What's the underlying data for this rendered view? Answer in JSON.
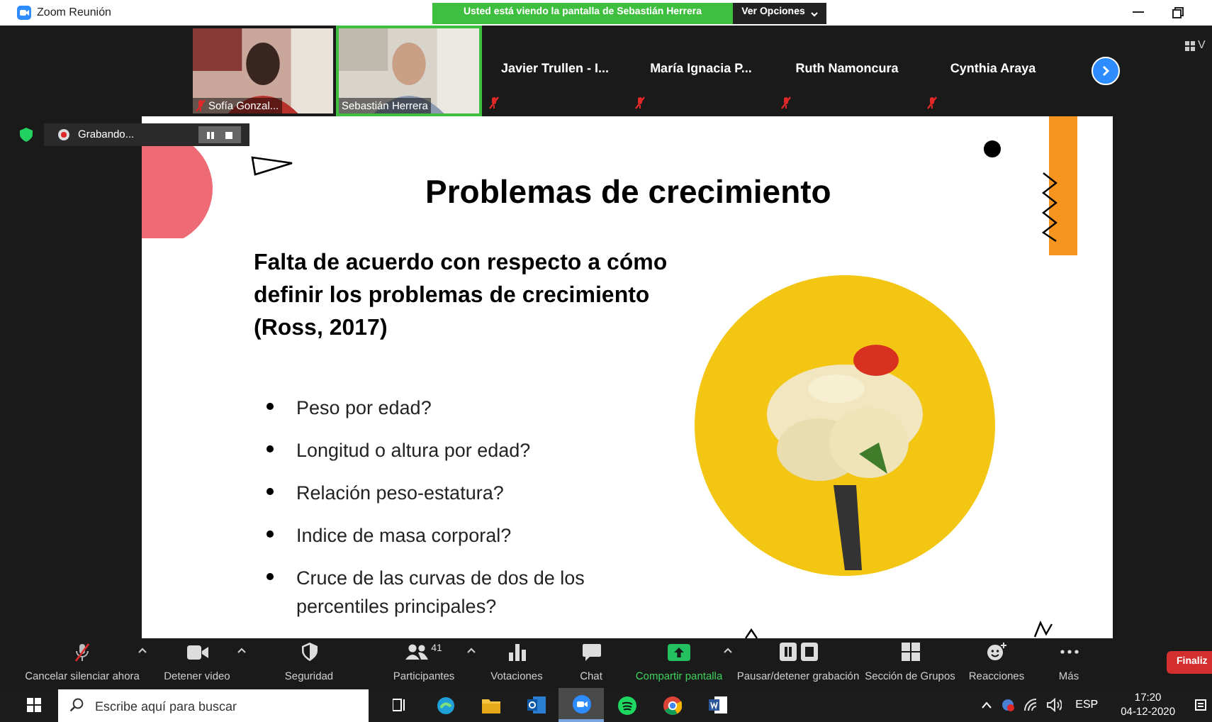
{
  "window": {
    "title": "Zoom Reunión"
  },
  "share_banner": {
    "text": "Usted está viendo la pantalla de Sebastián Herrera",
    "options": "Ver Opciones"
  },
  "gallery": [
    {
      "kind": "video",
      "name": "Sofía Gonzal...",
      "muted": true,
      "active_speaker": false
    },
    {
      "kind": "video",
      "name": "Sebastián Herrera",
      "muted": false,
      "active_speaker": true
    },
    {
      "kind": "name",
      "name": "Javier Trullen - I...",
      "muted": true,
      "active_speaker": false
    },
    {
      "kind": "name",
      "name": "María Ignacia P...",
      "muted": true,
      "active_speaker": false
    },
    {
      "kind": "name",
      "name": "Ruth Namoncura",
      "muted": true,
      "active_speaker": false
    },
    {
      "kind": "name",
      "name": "Cynthia Araya",
      "muted": true,
      "active_speaker": false
    }
  ],
  "view_label": "V",
  "recording": {
    "label": "Grabando..."
  },
  "slide": {
    "title": "Problemas de crecimiento",
    "subtitle": "Falta de acuerdo con respecto a cómo definir los problemas de crecimiento (Ross, 2017)",
    "bullets": [
      "Peso por edad?",
      "Longitud o altura por edad?",
      "Relación peso-estatura?",
      "Indice de masa corporal?",
      "Cruce de las curvas de dos de los percentiles principales?"
    ]
  },
  "toolbar": [
    {
      "kind": "mic",
      "label": "Cancelar silenciar ahora",
      "caret": true,
      "highlight": false
    },
    {
      "kind": "video",
      "label": "Detener video",
      "caret": true,
      "highlight": false
    },
    {
      "kind": "security",
      "label": "Seguridad",
      "caret": false,
      "highlight": false
    },
    {
      "kind": "participants",
      "label": "Participantes",
      "count": "41",
      "caret": true,
      "highlight": false
    },
    {
      "kind": "polls",
      "label": "Votaciones",
      "caret": false,
      "highlight": false
    },
    {
      "kind": "chat",
      "label": "Chat",
      "caret": false,
      "highlight": false
    },
    {
      "kind": "share",
      "label": "Compartir pantalla",
      "caret": true,
      "highlight": true
    },
    {
      "kind": "record",
      "label": "Pausar/detener grabación",
      "caret": false,
      "highlight": false
    },
    {
      "kind": "rooms",
      "label": "Sección de Grupos",
      "caret": false,
      "highlight": false
    },
    {
      "kind": "reactions",
      "label": "Reacciones",
      "caret": false,
      "highlight": false
    },
    {
      "kind": "more",
      "label": "Más",
      "caret": false,
      "highlight": false
    }
  ],
  "end_button": "Finaliz",
  "taskbar": {
    "search_placeholder": "Escribe aquí para buscar",
    "apps": [
      {
        "kind": "taskview",
        "selected": false
      },
      {
        "kind": "edge",
        "selected": false
      },
      {
        "kind": "explorer",
        "selected": false
      },
      {
        "kind": "outlook",
        "selected": false
      },
      {
        "kind": "zoom",
        "selected": true
      },
      {
        "kind": "spotify",
        "selected": false
      },
      {
        "kind": "chrome",
        "selected": false
      },
      {
        "kind": "word",
        "selected": false
      }
    ],
    "language": "ESP",
    "time": "17:20",
    "date": "04-12-2020"
  }
}
